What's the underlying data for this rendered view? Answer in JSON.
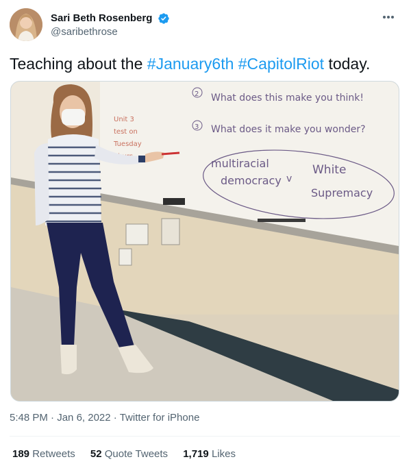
{
  "tweet": {
    "author": {
      "display_name": "Sari Beth Rosenberg",
      "handle": "@saribethrose",
      "verified": true,
      "verified_color": "#1d9bf0"
    },
    "text_before": "Teaching about the ",
    "hashtags": [
      "#January6th",
      "#CapitolRiot"
    ],
    "text_after": " today.",
    "hashtag_color": "#1d9bf0",
    "time": "5:48 PM",
    "date": "Jan 6, 2022",
    "client": "Twitter for iPhone",
    "more_icon": "ellipsis-icon"
  },
  "whiteboard": {
    "q2_number": "2",
    "q2": "What does this make you think!",
    "q3_number": "3",
    "q3": "What does it make you wonder?",
    "unit_note": [
      "Unit 3",
      "test on",
      "Tuesday",
      "Thurs"
    ],
    "left_term": [
      "multiracial",
      "democracy"
    ],
    "versus": "v",
    "right_term": [
      "White",
      "Supremacy"
    ]
  },
  "stats": [
    {
      "count": "189",
      "label": "Retweets"
    },
    {
      "count": "52",
      "label": "Quote Tweets"
    },
    {
      "count": "1,719",
      "label": "Likes"
    }
  ]
}
